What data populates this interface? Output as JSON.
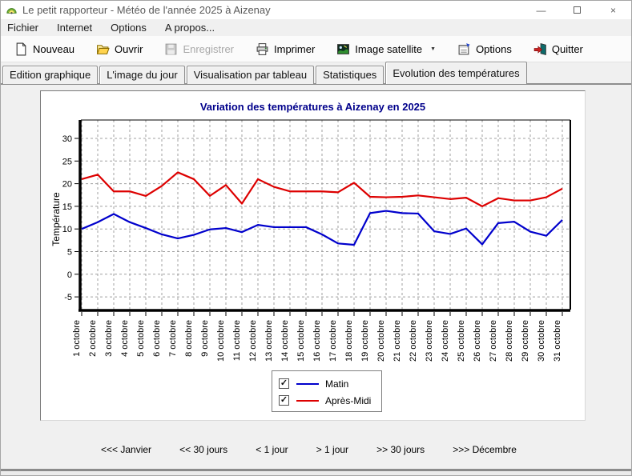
{
  "window": {
    "title": "Le petit rapporteur - Météo de l'année 2025 à Aizenay",
    "controls": {
      "minimize_glyph": "—",
      "close_glyph": "×"
    }
  },
  "icons": {
    "check_glyph": "✓",
    "dropdown_glyph": "▼"
  },
  "menu": {
    "items": [
      "Fichier",
      "Internet",
      "Options",
      "A propos..."
    ]
  },
  "toolbar": {
    "buttons": [
      {
        "label": "Nouveau",
        "icon": "new-document-icon",
        "enabled": true
      },
      {
        "label": "Ouvrir",
        "icon": "open-folder-icon",
        "enabled": true
      },
      {
        "label": "Enregistrer",
        "icon": "save-icon",
        "enabled": false
      },
      {
        "label": "Imprimer",
        "icon": "printer-icon",
        "enabled": true
      },
      {
        "label": "Image satellite",
        "icon": "satellite-image-icon",
        "enabled": true,
        "dropdown": true
      },
      {
        "label": "Options",
        "icon": "options-icon",
        "enabled": true
      },
      {
        "label": "Quitter",
        "icon": "quit-door-icon",
        "enabled": true
      }
    ]
  },
  "tabs": {
    "items": [
      "Edition graphique",
      "L'image du jour",
      "Visualisation par tableau",
      "Statistiques",
      "Evolution des températures"
    ],
    "active": "Evolution des températures"
  },
  "chart_data": {
    "type": "line",
    "title": "Variation des températures à Aizenay en 2025",
    "title_color": "#00008b",
    "ylabel": "Température",
    "xlabel": "",
    "grid": true,
    "grid_color": "#a0a0a0",
    "axis_color": "#000000",
    "ylim": [
      -8,
      34
    ],
    "yticks": [
      30,
      25,
      20,
      15,
      10,
      5,
      0,
      -5
    ],
    "legend_position": "bottom",
    "categories": [
      "1 octobre",
      "2 octobre",
      "3 octobre",
      "4 octobre",
      "5 octobre",
      "6 octobre",
      "7 octobre",
      "8 octobre",
      "9 octobre",
      "10 octobre",
      "11 octobre",
      "12 octobre",
      "13 octobre",
      "14 octobre",
      "15 octobre",
      "16 octobre",
      "17 octobre",
      "18 octobre",
      "19 octobre",
      "20 octobre",
      "21 octobre",
      "22 octobre",
      "23 octobre",
      "24 octobre",
      "25 octobre",
      "26 octobre",
      "27 octobre",
      "28 octobre",
      "29 octobre",
      "30 octobre",
      "31 octobre"
    ],
    "series": [
      {
        "name": "Matin",
        "color": "#0000cc",
        "checked": true,
        "values": [
          10,
          11.5,
          13.3,
          11.5,
          10.2,
          8.8,
          7.9,
          8.7,
          9.9,
          10.2,
          9.3,
          10.9,
          10.4,
          10.4,
          10.4,
          8.8,
          6.8,
          6.5,
          13.5,
          14,
          13.5,
          13.4,
          9.5,
          8.9,
          10.1,
          6.6,
          11.3,
          11.6,
          9.4,
          8.5,
          12
        ]
      },
      {
        "name": "Après-Midi",
        "color": "#dd0000",
        "checked": true,
        "values": [
          21,
          22,
          18.3,
          18.3,
          17.3,
          19.5,
          22.5,
          21,
          17.3,
          19.7,
          15.6,
          21,
          19.3,
          18.3,
          18.3,
          18.3,
          18.1,
          20.2,
          17.1,
          17,
          17.1,
          17.4,
          17,
          16.6,
          16.9,
          15,
          16.8,
          16.3,
          16.3,
          17,
          18.9
        ]
      }
    ]
  },
  "nav": {
    "links": [
      "<<< Janvier",
      "<< 30 jours",
      "< 1 jour",
      "> 1 jour",
      ">> 30 jours",
      ">>> Décembre"
    ]
  }
}
